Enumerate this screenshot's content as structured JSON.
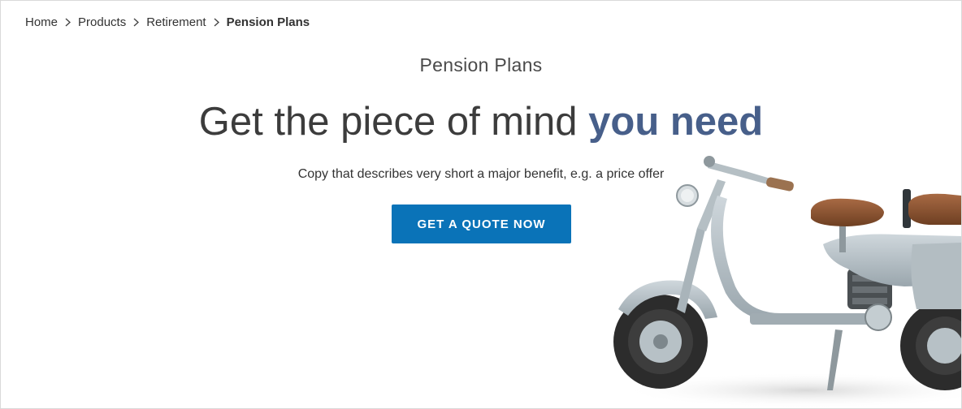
{
  "breadcrumb": {
    "items": [
      {
        "label": "Home"
      },
      {
        "label": "Products"
      },
      {
        "label": "Retirement"
      }
    ],
    "current": "Pension Plans"
  },
  "hero": {
    "eyebrow": "Pension Plans",
    "headline_plain": "Get the piece of mind ",
    "headline_accent": "you need",
    "benefit_copy": "Copy that describes very short a major benefit, e.g. a price offer",
    "cta_label": "GET A QUOTE NOW"
  },
  "icons": {
    "breadcrumb_separator": "chevron-right-icon",
    "hero_image": "scooter-image"
  },
  "colors": {
    "accent": "#475f8a",
    "cta_background": "#0a73b8",
    "cta_text": "#ffffff",
    "text": "#333333"
  }
}
